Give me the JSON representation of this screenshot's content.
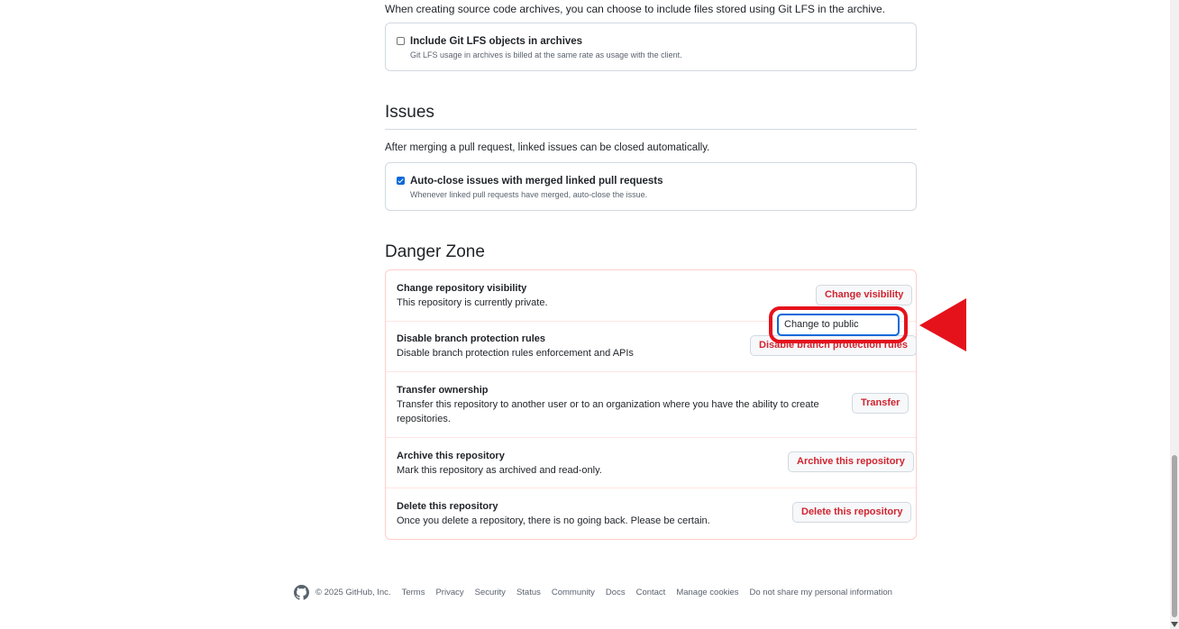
{
  "archives": {
    "description": "When creating source code archives, you can choose to include files stored using Git LFS in the archive.",
    "lfs_option": {
      "label": "Include Git LFS objects in archives",
      "note": "Git LFS usage in archives is billed at the same rate as usage with the client.",
      "checked": false
    }
  },
  "issues": {
    "heading": "Issues",
    "description": "After merging a pull request, linked issues can be closed automatically.",
    "auto_close_option": {
      "label": "Auto-close issues with merged linked pull requests",
      "note": "Whenever linked pull requests have merged, auto-close the issue.",
      "checked": true
    }
  },
  "danger_zone": {
    "heading": "Danger Zone",
    "rows": [
      {
        "title": "Change repository visibility",
        "description": "This repository is currently private.",
        "button": "Change visibility"
      },
      {
        "title": "Disable branch protection rules",
        "description": "Disable branch protection rules enforcement and APIs",
        "button": "Disable branch protection rules"
      },
      {
        "title": "Transfer ownership",
        "description": "Transfer this repository to another user or to an organization where you have the ability to create repositories.",
        "button": "Transfer"
      },
      {
        "title": "Archive this repository",
        "description": "Mark this repository as archived and read-only.",
        "button": "Archive this repository"
      },
      {
        "title": "Delete this repository",
        "description": "Once you delete a repository, there is no going back. Please be certain.",
        "button": "Delete this repository"
      }
    ],
    "visibility_menu": {
      "option": "Change to public"
    }
  },
  "footer": {
    "copyright": "© 2025 GitHub, Inc.",
    "links": [
      "Terms",
      "Privacy",
      "Security",
      "Status",
      "Community",
      "Docs",
      "Contact",
      "Manage cookies",
      "Do not share my personal information"
    ]
  },
  "annotation": {
    "highlight_color": "#e5121c"
  },
  "colors": {
    "danger_text": "#d1242f",
    "accent_blue": "#0969da",
    "border": "#d1d9e0",
    "muted_text": "#59636e"
  },
  "icons": {
    "footer_logo": "github-mark-icon",
    "scroll_down": "triangle-down-icon"
  }
}
